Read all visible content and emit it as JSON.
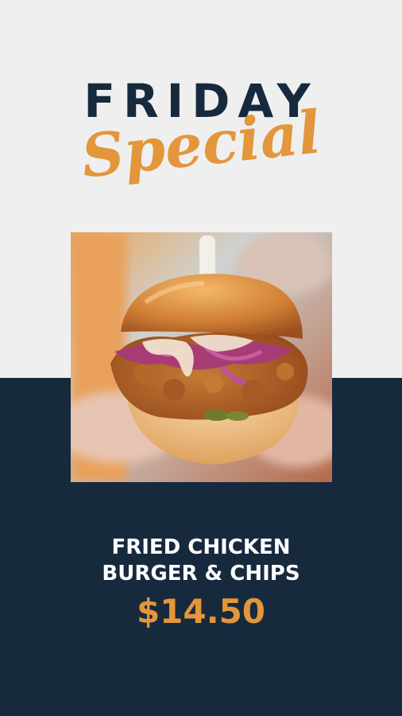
{
  "heading": {
    "title": "FRIDAY",
    "subtitle": "Special"
  },
  "item": {
    "name": "FRIED CHICKEN\nBURGER & CHIPS",
    "price": "$14.50"
  },
  "colors": {
    "navy": "#172a3d",
    "light_bg": "#efefef",
    "accent_orange": "#e3963b",
    "text_white": "#ffffff"
  }
}
